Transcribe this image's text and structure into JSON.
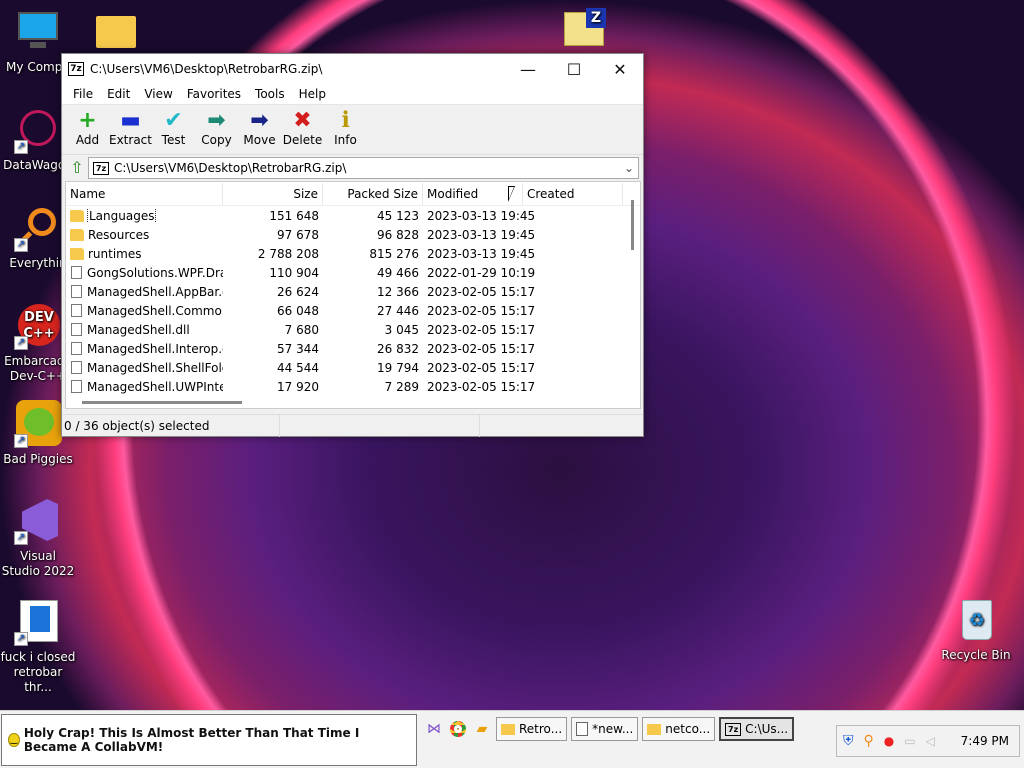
{
  "desktop": {
    "icons": [
      {
        "label": "My Compu"
      },
      {
        "label": ""
      },
      {
        "label": "DataWagon"
      },
      {
        "label": "Everythin"
      },
      {
        "label": "Embarcade Dev-C++"
      },
      {
        "label": "Bad Piggies"
      },
      {
        "label": "Visual Studio 2022"
      },
      {
        "label": "fuck i closed retrobar thr..."
      },
      {
        "label": "Recycle Bin"
      },
      {
        "label": ""
      }
    ]
  },
  "window": {
    "title": "C:\\Users\\VM6\\Desktop\\RetrobarRG.zip\\",
    "app_icon_text": "7z",
    "menu": [
      "File",
      "Edit",
      "View",
      "Favorites",
      "Tools",
      "Help"
    ],
    "toolbar": [
      {
        "label": "Add",
        "icon": "+",
        "color": "#22aa22"
      },
      {
        "label": "Extract",
        "icon": "▬",
        "color": "#1a2fcf"
      },
      {
        "label": "Test",
        "icon": "✔",
        "color": "#22b8c8"
      },
      {
        "label": "Copy",
        "icon": "➡",
        "color": "#1c8a74"
      },
      {
        "label": "Move",
        "icon": "➡",
        "color": "#1a2388"
      },
      {
        "label": "Delete",
        "icon": "✖",
        "color": "#d41e1e"
      },
      {
        "label": "Info",
        "icon": "ℹ",
        "color": "#b89a00"
      }
    ],
    "address": "C:\\Users\\VM6\\Desktop\\RetrobarRG.zip\\",
    "columns": {
      "name": "Name",
      "size": "Size",
      "packed": "Packed Size",
      "modified": "Modified",
      "created": "Created"
    },
    "rows": [
      {
        "name": "Languages",
        "size": "151 648",
        "packed": "45 123",
        "modified": "2023-03-13 19:45",
        "type": "folder"
      },
      {
        "name": "Resources",
        "size": "97 678",
        "packed": "96 828",
        "modified": "2023-03-13 19:45",
        "type": "folder"
      },
      {
        "name": "runtimes",
        "size": "2 788 208",
        "packed": "815 276",
        "modified": "2023-03-13 19:45",
        "type": "folder"
      },
      {
        "name": "GongSolutions.WPF.Dra...",
        "size": "110 904",
        "packed": "49 466",
        "modified": "2022-01-29 10:19",
        "type": "file"
      },
      {
        "name": "ManagedShell.AppBar.dll",
        "size": "26 624",
        "packed": "12 366",
        "modified": "2023-02-05 15:17",
        "type": "file"
      },
      {
        "name": "ManagedShell.Commo...",
        "size": "66 048",
        "packed": "27 446",
        "modified": "2023-02-05 15:17",
        "type": "file"
      },
      {
        "name": "ManagedShell.dll",
        "size": "7 680",
        "packed": "3 045",
        "modified": "2023-02-05 15:17",
        "type": "file"
      },
      {
        "name": "ManagedShell.Interop.dll",
        "size": "57 344",
        "packed": "26 832",
        "modified": "2023-02-05 15:17",
        "type": "file"
      },
      {
        "name": "ManagedShell.ShellFold...",
        "size": "44 544",
        "packed": "19 794",
        "modified": "2023-02-05 15:17",
        "type": "file"
      },
      {
        "name": "ManagedShell.UWPInte...",
        "size": "17 920",
        "packed": "7 289",
        "modified": "2023-02-05 15:17",
        "type": "file"
      }
    ],
    "status": "0 / 36 object(s) selected"
  },
  "taskbar": {
    "banner": "Holy Crap! This Is Almost Better Than That Time I Became A CollabVM!",
    "buttons": [
      {
        "label": "Retro..."
      },
      {
        "label": "*new..."
      },
      {
        "label": "netco..."
      },
      {
        "label": "C:\\Us..."
      }
    ],
    "clock": "7:49 PM"
  }
}
